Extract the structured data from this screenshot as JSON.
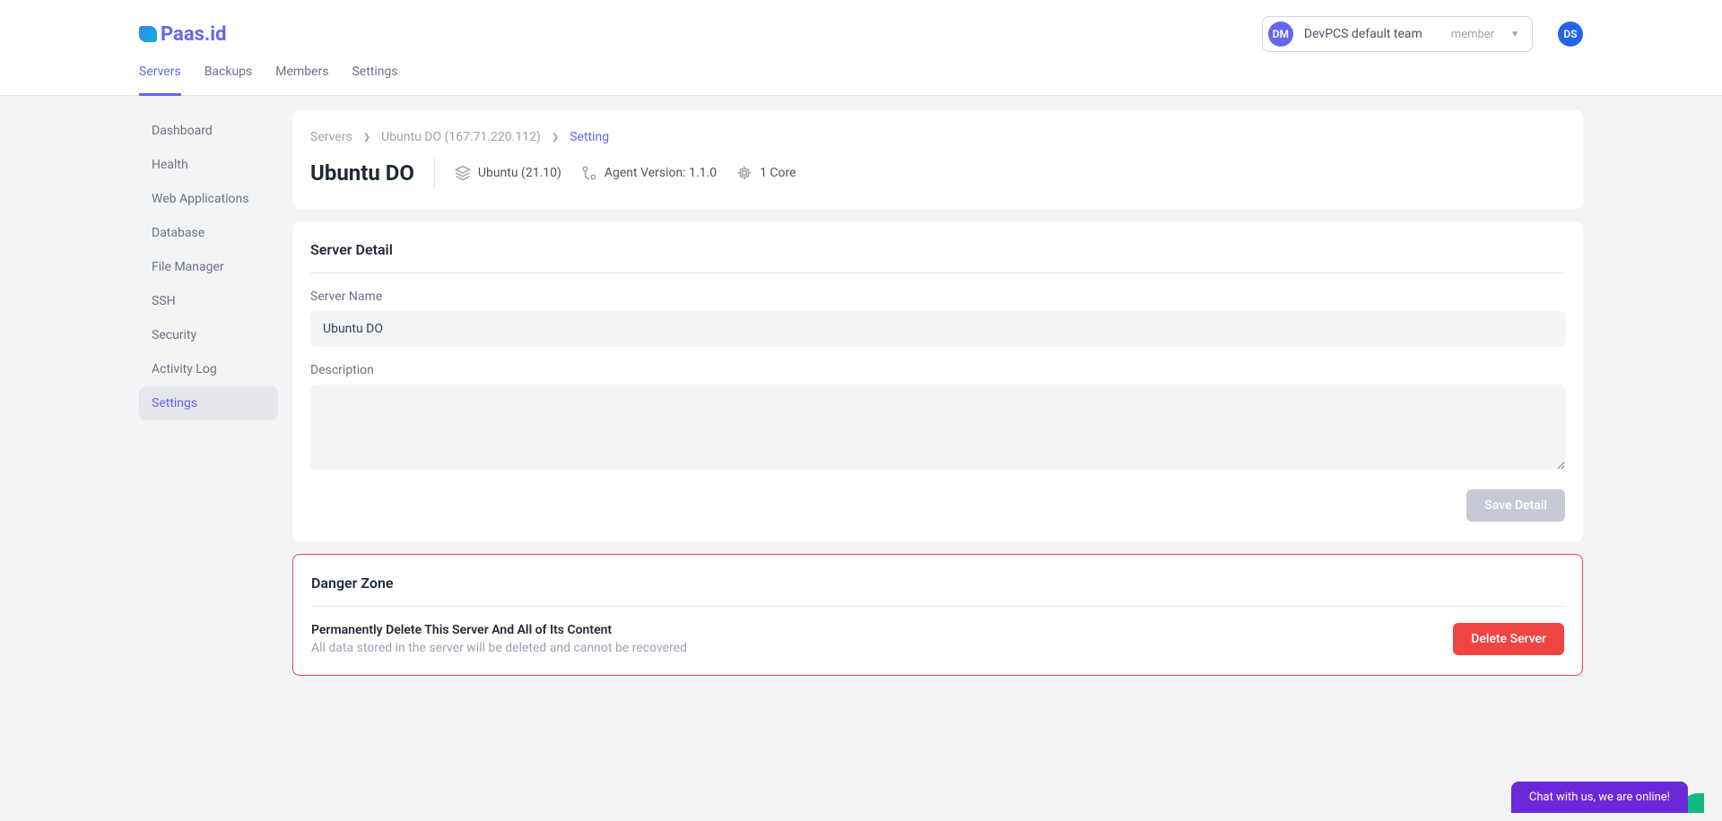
{
  "brand": "Paas.id",
  "team": {
    "avatar": "DM",
    "name": "DevPCS default team",
    "role": "member"
  },
  "userAvatar": "DS",
  "nav": {
    "items": [
      "Servers",
      "Backups",
      "Members",
      "Settings"
    ],
    "activeIndex": 0
  },
  "sidebar": {
    "items": [
      "Dashboard",
      "Health",
      "Web Applications",
      "Database",
      "File Manager",
      "SSH",
      "Security",
      "Activity Log",
      "Settings"
    ],
    "activeIndex": 8
  },
  "breadcrumb": {
    "root": "Servers",
    "server": "Ubuntu DO (167.71.220.112)",
    "current": "Setting"
  },
  "header": {
    "title": "Ubuntu DO",
    "os": "Ubuntu (21.10)",
    "agent": "Agent Version: 1.1.0",
    "cores": "1 Core"
  },
  "detail": {
    "sectionTitle": "Server Detail",
    "nameLabel": "Server Name",
    "nameValue": "Ubuntu DO",
    "descLabel": "Description",
    "descValue": "",
    "saveLabel": "Save Detail"
  },
  "danger": {
    "sectionTitle": "Danger Zone",
    "title": "Permanently Delete This Server And All of Its Content",
    "sub": "All data stored in the server will be deleted and cannot be recovered",
    "deleteLabel": "Delete Server"
  },
  "chat": "Chat with us, we are online!"
}
